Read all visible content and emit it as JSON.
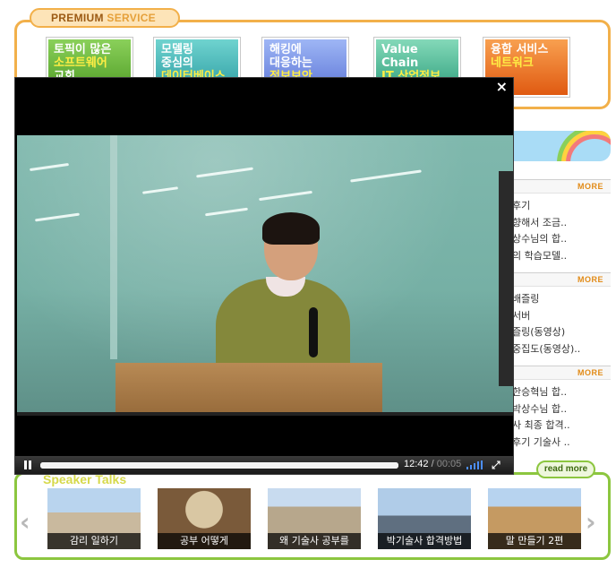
{
  "premium": {
    "label_main": "PREMIUM",
    "label_service": "SERVICE",
    "tiles": [
      {
        "line1": "토픽이 많은",
        "line2": "소프트웨어",
        "line3": "교회"
      },
      {
        "line1": "모델링",
        "line2": "중심의",
        "line3": "데이터베이스"
      },
      {
        "line1": "해킹에",
        "line2": "대응하는",
        "line3": "정보보안"
      },
      {
        "line1": "Value",
        "line2": "Chain",
        "line3": "IT 산업정보"
      },
      {
        "line1": "융합 서비스",
        "line2": "",
        "line3": "네트워크"
      }
    ]
  },
  "sections": [
    {
      "more": "MORE",
      "items": [
        "후기",
        "향해서 조금..",
        "상수님의 합..",
        "의 학습모델.."
      ]
    },
    {
      "more": "MORE",
      "items": [
        "배즐링",
        "서버",
        "즐링(동영상)",
        "중집도(동영상).."
      ]
    },
    {
      "more": "MORE",
      "items": [
        "한승혁님 합..",
        "박상수님 합..",
        "사 최종 합격..",
        "후기 기술사 .."
      ]
    }
  ],
  "speaker": {
    "title": "Speaker Talks",
    "read_more": "read more",
    "prev_arrow": "‹",
    "next_arrow": "›",
    "videos": [
      {
        "caption": "감리 일하기"
      },
      {
        "caption": "공부 어떻게"
      },
      {
        "caption": "왜 기술사 공부를"
      },
      {
        "caption": "박기술사 합격방법"
      },
      {
        "caption": "말 만들기 2편"
      }
    ]
  },
  "player": {
    "close": "×",
    "current_time": "12:42",
    "separator": "/",
    "duration": "00:05",
    "progress_fraction": 1.0,
    "fullscreen": "⤢"
  },
  "colors": {
    "premium_border": "#f2b04a",
    "speaker_border": "#8cc63f",
    "more_text": "#e28b17",
    "volume_bars": "#4c8ef7"
  }
}
